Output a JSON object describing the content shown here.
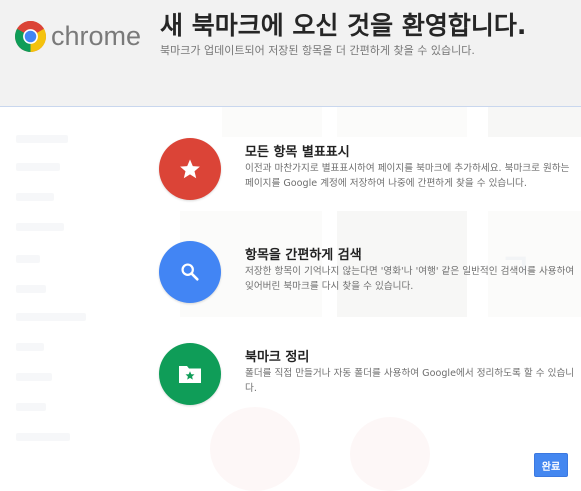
{
  "header": {
    "logo_text": "chrome",
    "title": "새 북마크에 오신 것을 환영합니다.",
    "subtitle": "북마크가 업데이트되어 저장된 항목을 더 간편하게 찾을 수 있습니다."
  },
  "features": [
    {
      "icon": "star-icon",
      "color": "#db4437",
      "title": "모든 항목 별표표시",
      "description": "이전과 마찬가지로 별표표시하여 페이지를 북마크에 추가하세요. 북마크로 원하는 페이지를 Google 계정에 저장하여 나중에 간편하게 찾을 수 있습니다."
    },
    {
      "icon": "search-icon",
      "color": "#4285f4",
      "title": "항목을 간편하게 검색",
      "description": "저장한 항목이 기억나지 않는다면 '영화'나 '여행' 같은 일반적인 검색어를 사용하여 잊어버린 북마크를 다시 찾을 수 있습니다."
    },
    {
      "icon": "folder-star-icon",
      "color": "#0f9d58",
      "title": "북마크 정리",
      "description": "폴더를 직접 만들거나 자동 폴더를 사용하여 Google에서 정리하도록 할 수 있습니다."
    }
  ],
  "done_button": {
    "label": "완료",
    "color": "#4487f0"
  }
}
